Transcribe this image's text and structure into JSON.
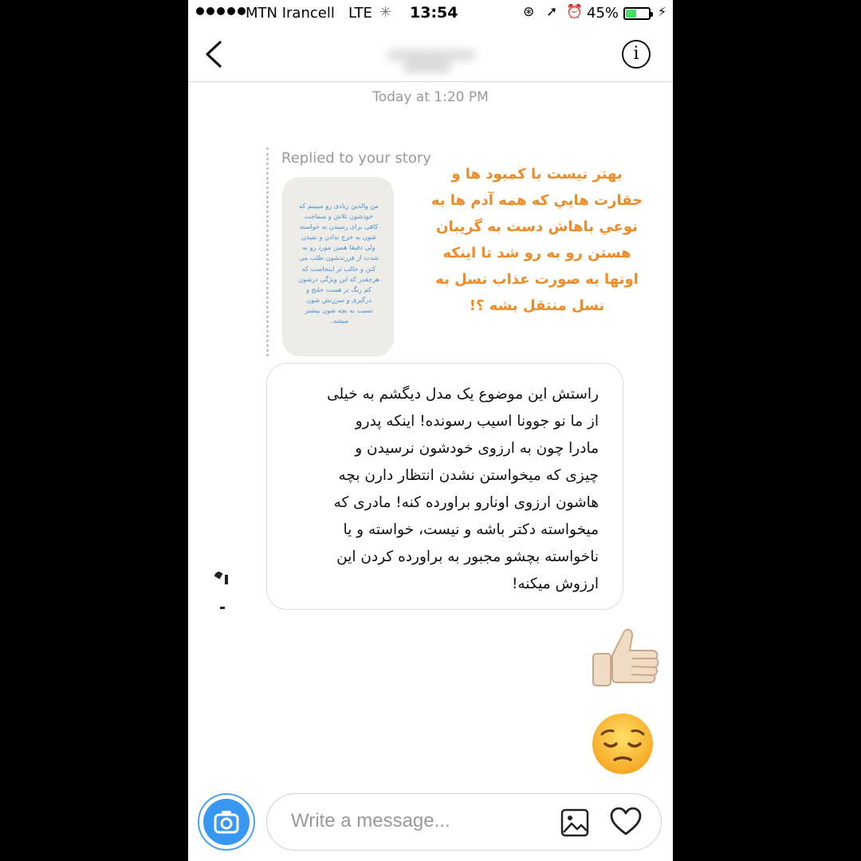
{
  "status_bar": {
    "carrier": "MTN Irancell",
    "network": "LTE",
    "time": "13:54",
    "battery": "45%",
    "battery_level": 0.45,
    "icons": [
      "signal-dots-icon",
      "loading-spinner-icon",
      "orientation-lock-icon",
      "location-arrow-icon",
      "alarm-icon",
      "battery-icon",
      "charging-bolt-icon"
    ]
  },
  "header": {
    "back_icon": "chevron-left-icon",
    "info_icon": "info-icon",
    "info_glyph": "i"
  },
  "conversation": {
    "timestamp": "Today at 1:20 PM",
    "story_reply": {
      "label": "Replied to your story",
      "story_image_text": "من والدین زیادی رو میبینم که\nخودشون تلاش و سماجت\nکافی برای رسیدن به خواسته\nشون به خرج ندادن و نمیدن\nولی دقیقا همین مورد رو به\nشدت از فرزندشون طلب می\nکنن و جالب تر اینجاست که\nهرچقدر که این ویژگی درشون\nکم رنگ تر هست جلنج و\nدرگیری و سرزنش شون\nنسبت به بچه شون بیشتر\nمیشه..",
      "overlay_text": "بهتر نیست با کمبود ها و\nحقارت هایي که همه آدم ها به\nنوعي باهاش دست به گریبان\nهستن رو به رو شد تا اینکه\nاونها به صورت عذاب نسل به\nنسل منتقل بشه ؟!"
    },
    "message": "راستش این موضوع یک مدل دیگشم به خیلی\nاز ما نو جوونا اسیب رسونده! اینکه پدرو\nمادرا چون به ارزوی خودشون نرسیدن و\nچیزی که میخواستن نشدن انتظار دارن بچه\nهاشون ارزوی اونارو براورده کنه! مادری که\nمیخواسته دکتر باشه و نیست، خواسته و یا\nناخواسته بچشو مجبور به براورده کردن این\nارزوش میکنه!",
    "reactions": [
      "thumbs-up-emoji",
      "pensive-face-emoji"
    ]
  },
  "composer": {
    "placeholder": "Write a message...",
    "camera_icon": "camera-icon",
    "gallery_icon": "gallery-icon",
    "heart_icon": "heart-icon"
  },
  "colors": {
    "accent_blue": "#3897f0",
    "story_text": "#4a90d9",
    "overlay_orange": "#f08a24",
    "battery_green": "#4cd964"
  }
}
